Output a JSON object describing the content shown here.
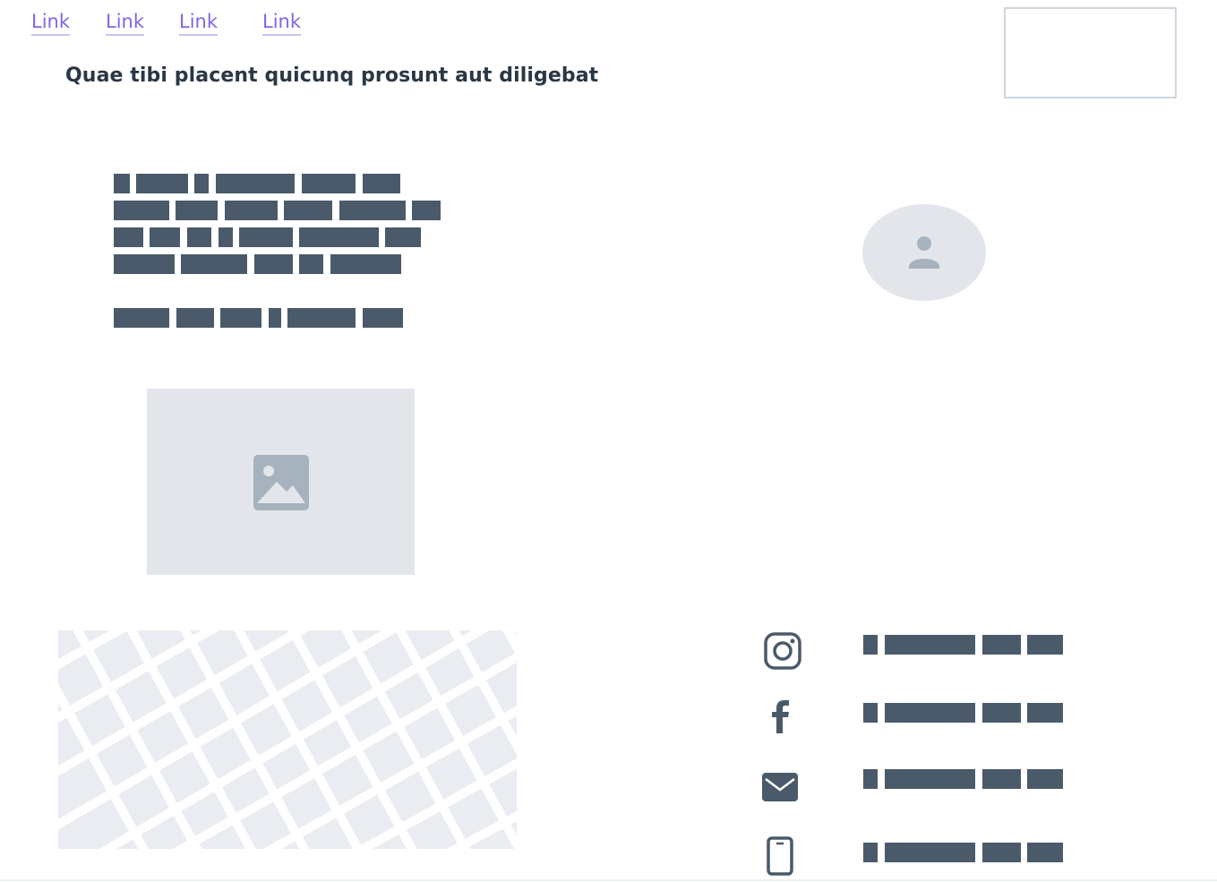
{
  "nav": {
    "links": [
      {
        "label": "Link"
      },
      {
        "label": "Link"
      },
      {
        "label": "Link"
      },
      {
        "label": "Link"
      }
    ]
  },
  "header": {
    "title": "Quae tibi placent quicunq prosunt aut diligebat"
  },
  "colors": {
    "link": "#7b68ee",
    "text_dark": "#2a3744",
    "placeholder_block": "#4a5a6a",
    "placeholder_bg": "#e2e6ea",
    "icon_grey": "#a6b2bd"
  },
  "icons": {
    "avatar": "user-icon",
    "image": "image-icon",
    "map": "map-placeholder",
    "social": [
      "instagram-icon",
      "facebook-icon",
      "mail-icon",
      "phone-icon"
    ]
  }
}
